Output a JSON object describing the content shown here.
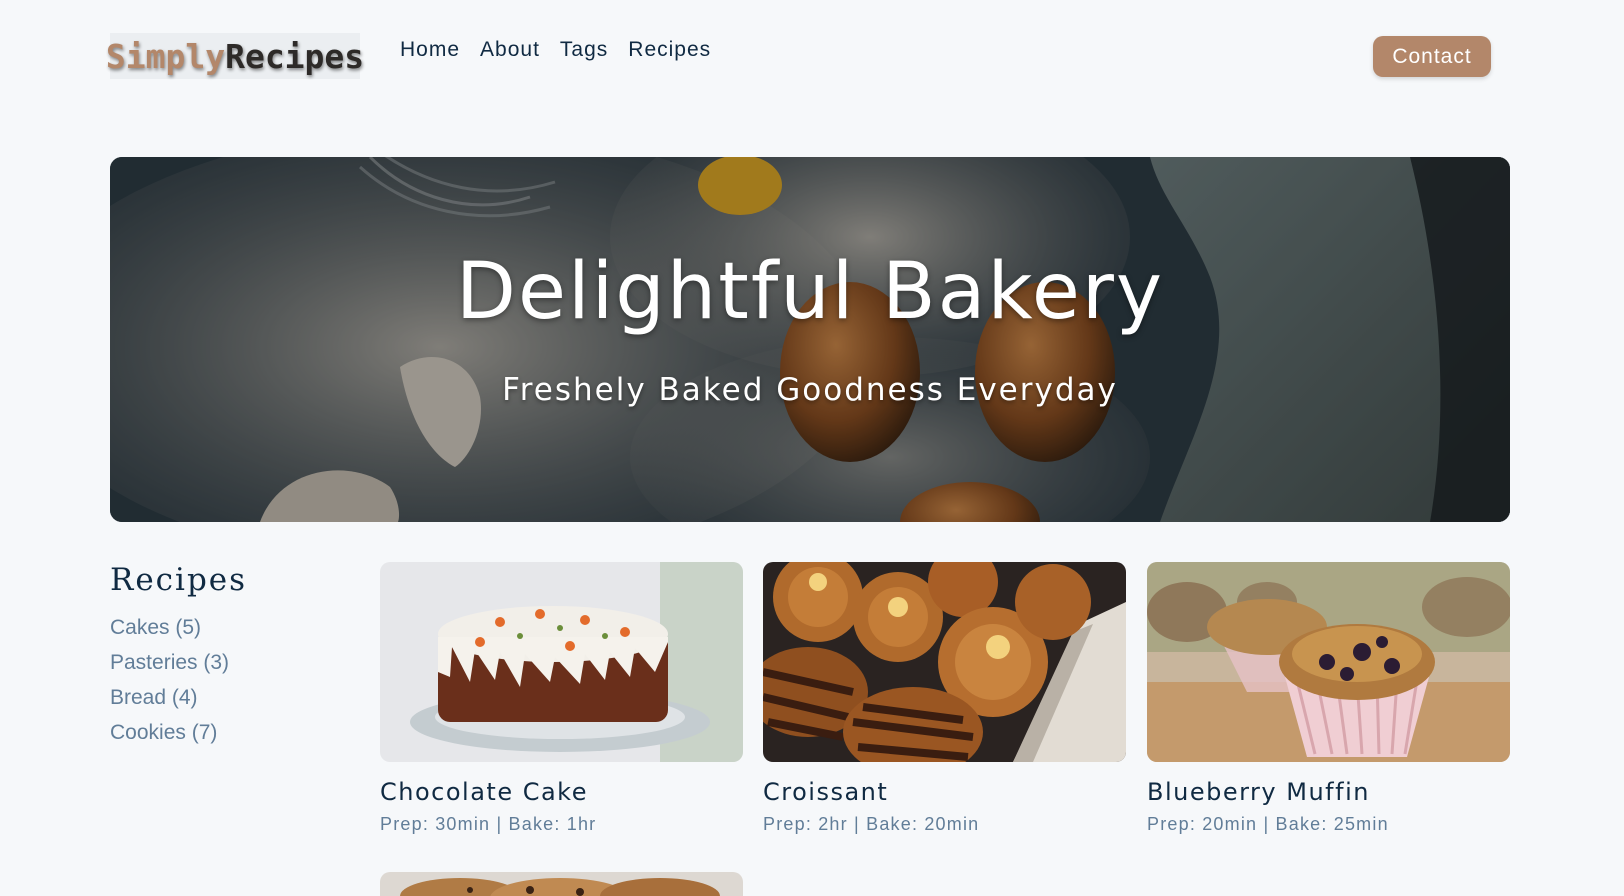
{
  "brand": {
    "part1": "Simply",
    "part2": "Recipes"
  },
  "nav": {
    "links": [
      "Home",
      "About",
      "Tags",
      "Recipes"
    ],
    "contact_label": "Contact"
  },
  "hero": {
    "title": "Delightful Bakery",
    "subtitle": "Freshely Baked Goodness Everyday"
  },
  "sidebar": {
    "title": "Recipes",
    "tags": [
      "Cakes (5)",
      "Pasteries (3)",
      "Bread (4)",
      "Cookies (7)"
    ]
  },
  "recipes": [
    {
      "title": "Chocolate Cake",
      "meta": "Prep: 30min | Bake: 1hr"
    },
    {
      "title": "Croissant",
      "meta": "Prep: 2hr | Bake: 20min"
    },
    {
      "title": "Blueberry Muffin",
      "meta": "Prep: 20min | Bake: 25min"
    }
  ],
  "colors": {
    "accent": "#b3876a",
    "text": "#102a42",
    "muted": "#617d98",
    "background": "#f6f8fa"
  }
}
